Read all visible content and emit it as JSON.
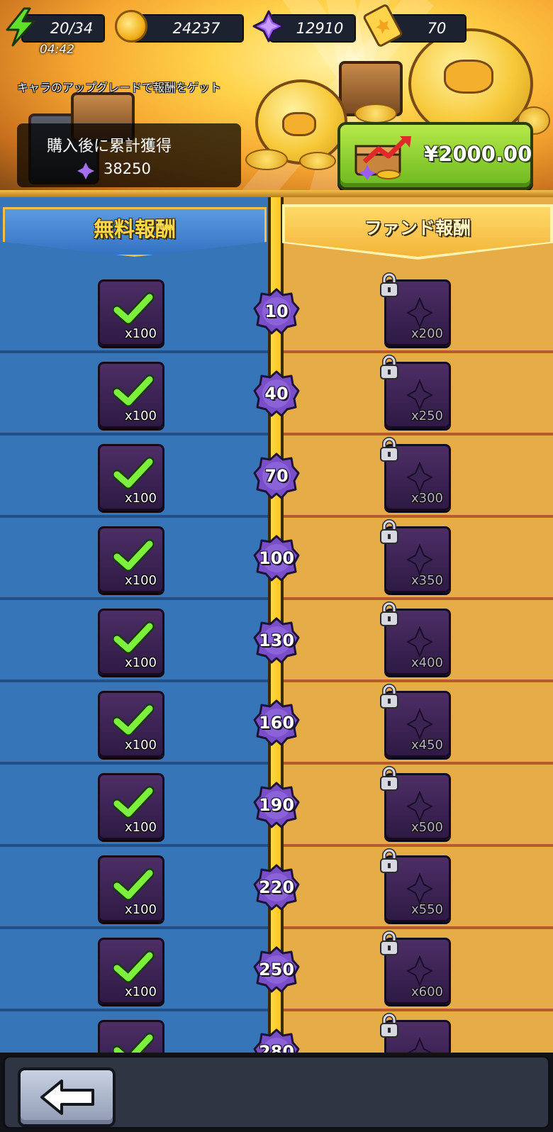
{
  "header": {
    "energy": "20/34",
    "energy_timer": "04:42",
    "coins": "24237",
    "gems": "12910",
    "tickets": "70",
    "subtitle": "キャラのアップグレードで報酬をゲット",
    "cumulative_label": "購入後に累計獲得",
    "cumulative_value": "38250",
    "price": "¥2000.00"
  },
  "tabs": {
    "free_label": "無料報酬",
    "fund_label": "ファンド報酬"
  },
  "rows": [
    {
      "level": "10",
      "free_qty": "x100",
      "fund_qty": "x200"
    },
    {
      "level": "40",
      "free_qty": "x100",
      "fund_qty": "x250"
    },
    {
      "level": "70",
      "free_qty": "x100",
      "fund_qty": "x300"
    },
    {
      "level": "100",
      "free_qty": "x100",
      "fund_qty": "x350"
    },
    {
      "level": "130",
      "free_qty": "x100",
      "fund_qty": "x400"
    },
    {
      "level": "160",
      "free_qty": "x100",
      "fund_qty": "x450"
    },
    {
      "level": "190",
      "free_qty": "x100",
      "fund_qty": "x500"
    },
    {
      "level": "220",
      "free_qty": "x100",
      "fund_qty": "x550"
    },
    {
      "level": "250",
      "free_qty": "x100",
      "fund_qty": "x600"
    },
    {
      "level": "280",
      "free_qty": "",
      "fund_qty": ""
    }
  ],
  "row_state": {
    "free": "claimed",
    "fund": "locked"
  },
  "icons": {
    "energy": "lightning-icon",
    "coins": "coin-icon",
    "gems": "gem-icon",
    "tickets": "ticket-icon",
    "claimed": "checkmark-icon",
    "locked": "lock-icon",
    "back": "back-arrow-icon"
  },
  "colors": {
    "free_column": "#3575b8",
    "fund_column": "#e6ac48",
    "buy_button": "#8ed02e",
    "level_badge": "#7a4ec8",
    "check": "#7cf03c"
  }
}
